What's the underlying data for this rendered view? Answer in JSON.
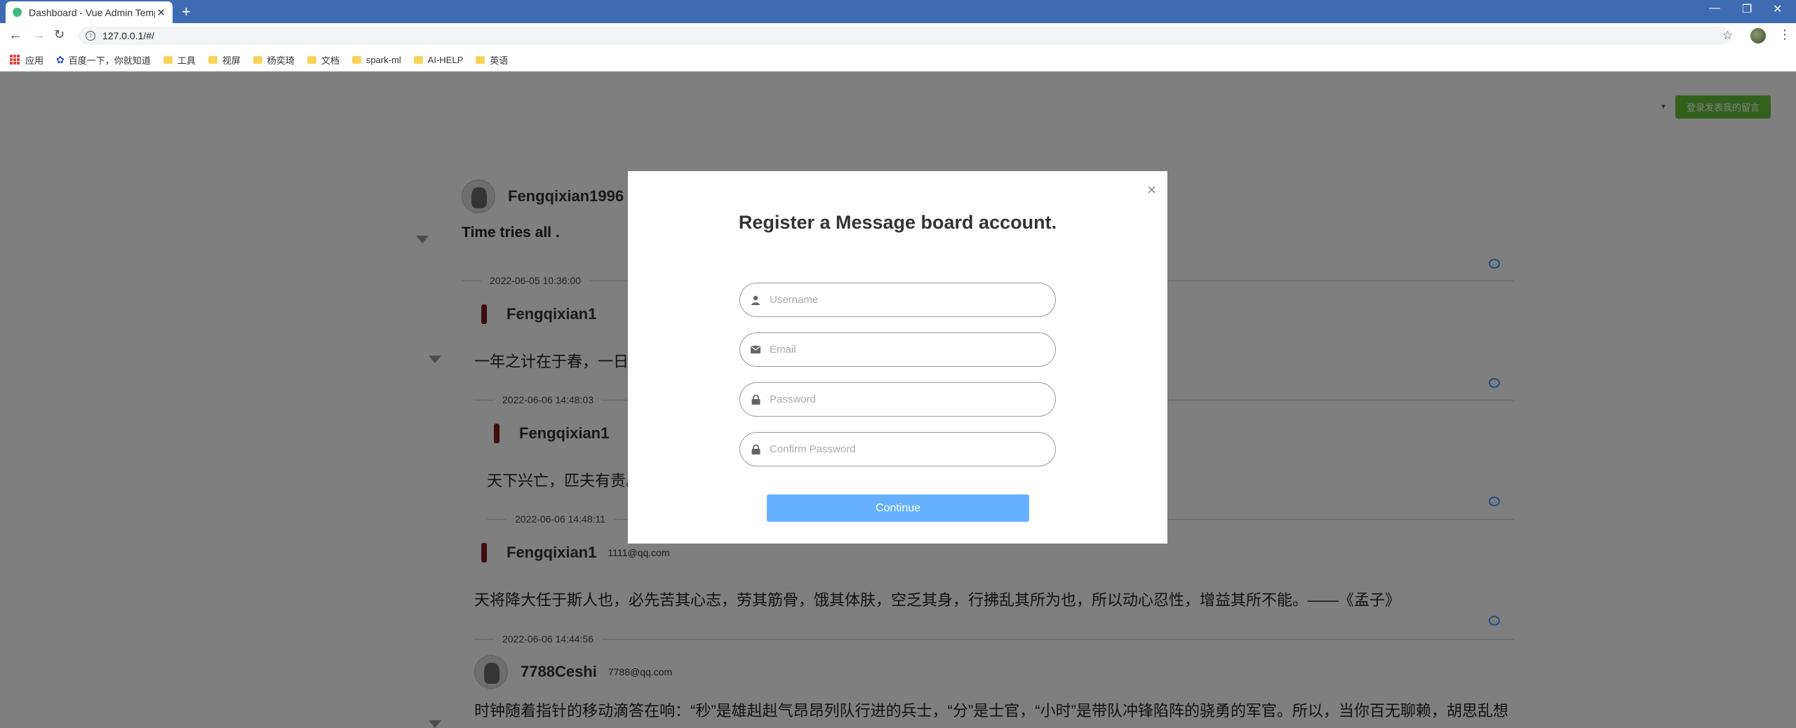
{
  "browser": {
    "tab_title": "Dashboard - Vue Admin Temp",
    "tab_close": "✕",
    "new_tab": "+",
    "url": "127.0.0.1/#/",
    "bookmarks": [
      {
        "label": "应用",
        "icon": "apps-grid-icon"
      },
      {
        "label": "百度一下，你就知道",
        "icon": "baidu-paw-icon"
      },
      {
        "label": "工具",
        "icon": "folder-icon"
      },
      {
        "label": "视屏",
        "icon": "folder-icon"
      },
      {
        "label": "杨奕琦",
        "icon": "folder-icon"
      },
      {
        "label": "文档",
        "icon": "folder-icon"
      },
      {
        "label": "spark-ml",
        "icon": "folder-icon"
      },
      {
        "label": "AI-HELP",
        "icon": "folder-icon"
      },
      {
        "label": "英语",
        "icon": "folder-icon"
      }
    ]
  },
  "header": {
    "login_button": "登录发表我的留言"
  },
  "messages": [
    {
      "name": "Fengqixian1996",
      "email": "",
      "content": "Time tries all .",
      "date": "2022-06-05 10:36:00"
    },
    {
      "name": "Fengqixian1",
      "email": "",
      "content": "一年之计在于春，一日",
      "date": "2022-06-06 14:48:03"
    },
    {
      "name": "Fengqixian1",
      "email": "",
      "content": "天下兴亡，匹夫有责。",
      "date": "2022-06-06 14:48:11"
    },
    {
      "name": "Fengqixian1",
      "email": "1111@qq.com",
      "content": "天将降大任于斯人也，必先苦其心志，劳其筋骨，饿其体肤，空乏其身，行拂乱其所为也，所以动心忍性，增益其所不能。——《孟子》",
      "date": "2022-06-06 14:44:56"
    },
    {
      "name": "7788Ceshi",
      "email": "7788@qq.com",
      "content": "时钟随着指针的移动滴答在响：“秒”是雄赳赳气昂昂列队行进的兵士，“分”是士官，“小时”是带队冲锋陷阵的骁勇的军官。所以，当你百无聊赖，胡思乱想",
      "date": ""
    }
  ],
  "dialog": {
    "title": "Register a Message board account.",
    "close": "×",
    "username_placeholder": "Username",
    "email_placeholder": "Email",
    "password_placeholder": "Password",
    "confirm_placeholder": "Confirm Password",
    "continue_label": "Continue"
  },
  "colors": {
    "tabbar": "#3f6bb4",
    "login_button": "#67c23a",
    "continue_button": "#66b1ff",
    "accent_icon": "#409eff"
  }
}
